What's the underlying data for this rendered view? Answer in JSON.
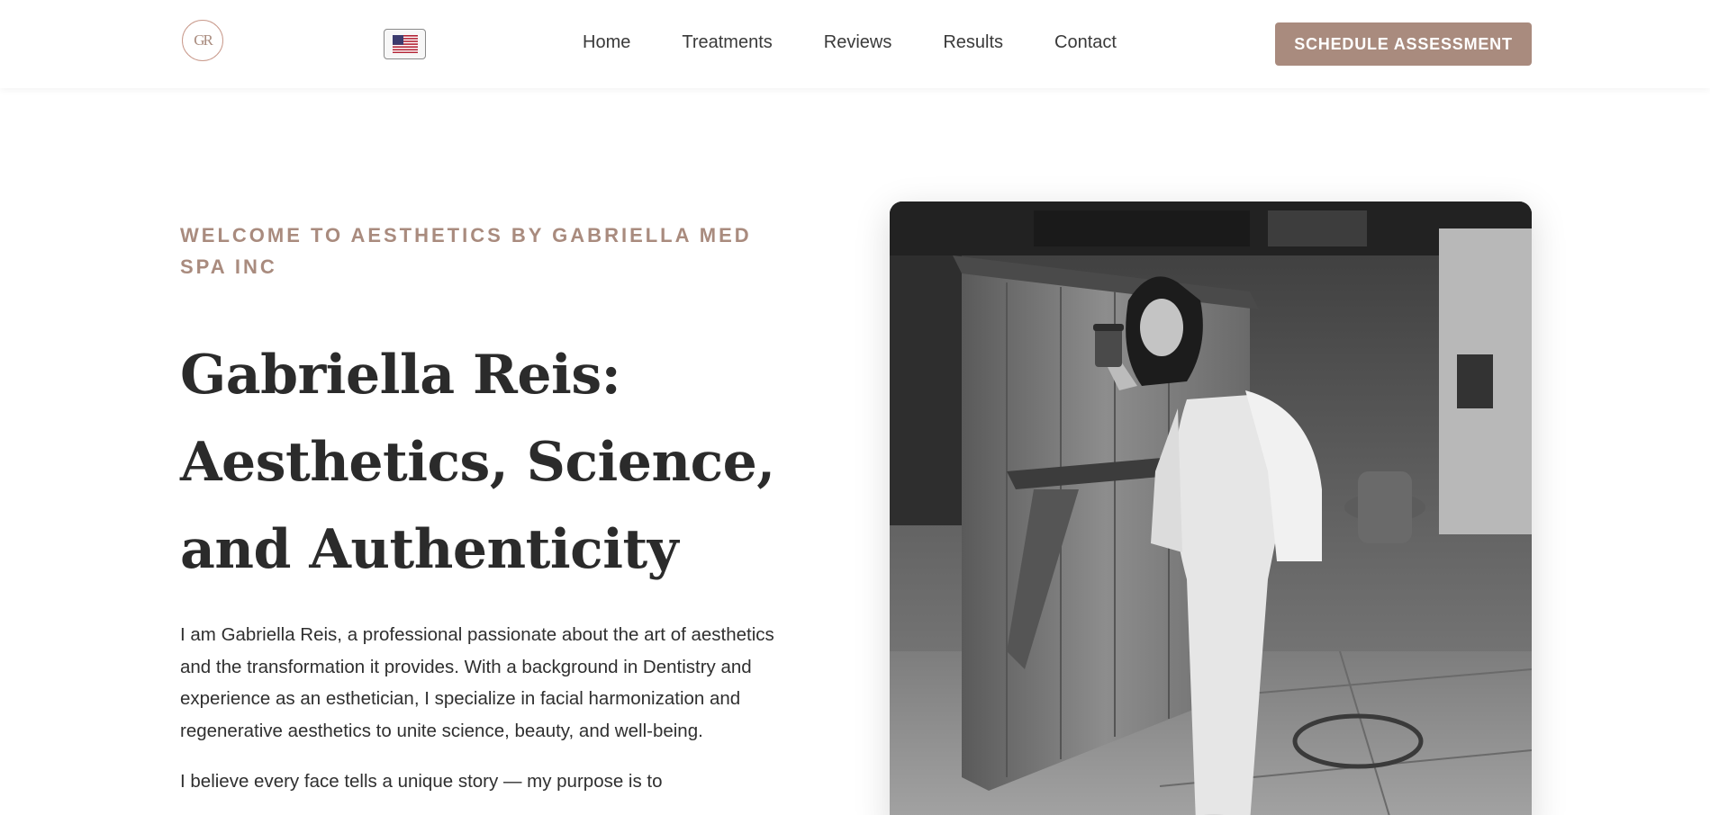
{
  "header": {
    "logo_text": "GR",
    "language_flag": "us-flag-icon",
    "nav": [
      "Home",
      "Treatments",
      "Reviews",
      "Results",
      "Contact"
    ],
    "cta_label": "SCHEDULE ASSESSMENT"
  },
  "hero": {
    "eyebrow": "WELCOME TO AESTHETICS BY GABRIELLA MED SPA INC",
    "title_line1": "Gabriella Reis:",
    "title_line2": "Aesthetics, Science,",
    "title_line3": "and Authenticity",
    "paragraph1": "I am Gabriella Reis, a professional passionate about the art of aesthetics and the transformation it provides. With a background in Dentistry and experience as an esthetician, I specialize in facial harmonization and regenerative aesthetics to unite science, beauty, and well-being.",
    "paragraph2": "I believe every face tells a unique story — my purpose is to"
  },
  "colors": {
    "accent": "#a98b7e",
    "text_dark": "#2b2b2b",
    "background": "#ffffff"
  }
}
